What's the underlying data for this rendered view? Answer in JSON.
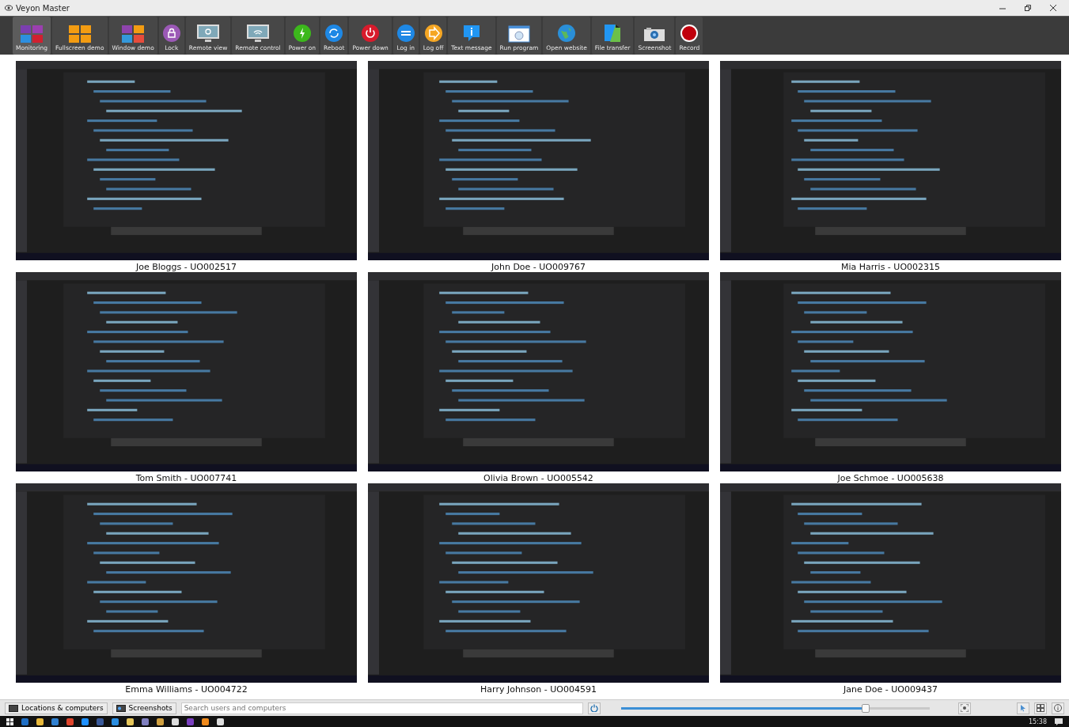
{
  "window": {
    "title": "Veyon Master"
  },
  "toolbar": [
    {
      "label": "Monitoring",
      "selected": true
    },
    {
      "label": "Fullscreen demo",
      "selected": false
    },
    {
      "label": "Window demo",
      "selected": false
    },
    {
      "label": "Lock",
      "selected": false
    },
    {
      "label": "Remote view",
      "selected": false
    },
    {
      "label": "Remote control",
      "selected": false
    },
    {
      "label": "Power on",
      "selected": false
    },
    {
      "label": "Reboot",
      "selected": false
    },
    {
      "label": "Power down",
      "selected": false
    },
    {
      "label": "Log in",
      "selected": false
    },
    {
      "label": "Log off",
      "selected": false
    },
    {
      "label": "Text message",
      "selected": false
    },
    {
      "label": "Run program",
      "selected": false
    },
    {
      "label": "Open website",
      "selected": false
    },
    {
      "label": "File transfer",
      "selected": false
    },
    {
      "label": "Screenshot",
      "selected": false
    },
    {
      "label": "Record",
      "selected": false
    }
  ],
  "computers": [
    {
      "label": "Joe Bloggs - UO002517"
    },
    {
      "label": "John Doe - UO009767"
    },
    {
      "label": "Mia Harris - UO002315"
    },
    {
      "label": "Tom Smith - UO007741"
    },
    {
      "label": "Olivia Brown - UO005542"
    },
    {
      "label": "Joe Schmoe - UO005638"
    },
    {
      "label": "Emma Williams - UO004722"
    },
    {
      "label": "Harry Johnson - UO004591"
    },
    {
      "label": "Jane Doe - UO009437"
    }
  ],
  "status_bar": {
    "panels": [
      {
        "label": "Locations & computers"
      },
      {
        "label": "Screenshots"
      }
    ],
    "search": {
      "placeholder": "Search users and computers"
    },
    "zoom": {
      "level": 0.78
    }
  },
  "taskbar": {
    "time": "15:38"
  }
}
